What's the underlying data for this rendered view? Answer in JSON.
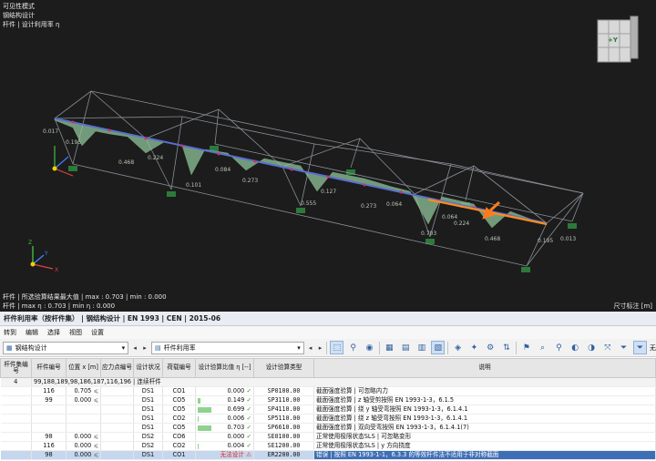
{
  "viewport": {
    "overlay_top": [
      "可见性模式",
      "钢结构设计",
      "杆件 | 设计利用率 η"
    ],
    "overlay_bottom": [
      "杆件 | 所选验算结果最大值 | max : 0.703 | min : 0.000",
      "杆件 | max η : 0.703 | min η : 0.000"
    ],
    "scale_label": "尺寸标注 [m]",
    "cube_label": "+Y",
    "axis_labels": {
      "x": "X",
      "y": "Y",
      "z": "Z"
    },
    "diagram_labels": [
      {
        "text": "0.017"
      },
      {
        "text": "0.195"
      },
      {
        "text": "0.468"
      },
      {
        "text": "0.224"
      },
      {
        "text": "0.101"
      },
      {
        "text": "0.084"
      },
      {
        "text": "0.273"
      },
      {
        "text": "0.555"
      },
      {
        "text": "0.127"
      },
      {
        "text": "0.273"
      },
      {
        "text": "0.064"
      },
      {
        "text": "0.703"
      },
      {
        "text": "0.224"
      },
      {
        "text": "0.468"
      },
      {
        "text": "0.195"
      },
      {
        "text": "0.013"
      },
      {
        "text": "0.064"
      }
    ]
  },
  "panel": {
    "title": "杆件利用率（按杆件集） | 钢结构设计 | EN 1993 | CEN | 2015-06",
    "menu": [
      "转到",
      "编辑",
      "选择",
      "视图",
      "设置"
    ],
    "combo_design": "钢结构设计",
    "combo_table": "杆件利用率",
    "toolbar_tail": "无"
  },
  "table": {
    "headers": {
      "set_no": "杆件集编号",
      "member_no": "杆件编号",
      "location": "位置 x [m]",
      "stress_point": "应力点编号",
      "design_situation": "设计状况",
      "loading": "荷载编号",
      "ratio": "设计验算比值 η [--]",
      "check_type": "设计验算类型",
      "description": "说明"
    },
    "group": {
      "set_no": "4",
      "members": "99,188,189,98,186,187,116,196 | 连续杆件"
    },
    "rows": [
      {
        "member": "116",
        "x": "0.705",
        "xmark": "⩽",
        "ds": "DS1",
        "load": "CO1",
        "ratio": "0.000",
        "ratio_val": 0.0,
        "check": "✓",
        "type": "SP0100.00",
        "desc": "截面强度验算 | 可忽略内力"
      },
      {
        "member": "99",
        "x": "0.000",
        "xmark": "⩽",
        "ds": "DS1",
        "load": "CO5",
        "ratio": "0.149",
        "ratio_val": 0.149,
        "check": "✓",
        "type": "SP3110.00",
        "desc": "截面强度验算 | z 轴受剪按照 EN 1993-1-3，6.1.5"
      },
      {
        "member": "",
        "x": "",
        "xmark": "",
        "ds": "DS1",
        "load": "CO5",
        "ratio": "0.699",
        "ratio_val": 0.699,
        "check": "✓",
        "type": "SP4110.00",
        "desc": "截面强度验算 | 绕 y 轴受弯按照 EN 1993-1-3，6.1.4.1"
      },
      {
        "member": "",
        "x": "",
        "xmark": "",
        "ds": "DS1",
        "load": "CO2",
        "ratio": "0.006",
        "ratio_val": 0.006,
        "check": "✓",
        "type": "SP5110.00",
        "desc": "截面强度验算 | 绕 z 轴受弯按照 EN 1993-1-3，6.1.4.1"
      },
      {
        "member": "",
        "x": "",
        "xmark": "",
        "ds": "DS1",
        "load": "CO5",
        "ratio": "0.703",
        "ratio_val": 0.703,
        "check": "✓",
        "type": "SP6610.00",
        "desc": "截面强度验算 | 双向受弯按照 EN 1993-1-3，6.1.4.1(7)"
      },
      {
        "member": "98",
        "x": "0.000",
        "xmark": "⩽",
        "ds": "DS2",
        "load": "CO6",
        "ratio": "0.000",
        "ratio_val": 0.0,
        "check": "✓",
        "type": "SE0100.00",
        "desc": "正常使用极限状态SLS | 可忽略变形"
      },
      {
        "member": "116",
        "x": "0.000",
        "xmark": "⩽",
        "ds": "DS2",
        "load": "CO2",
        "ratio": "0.004",
        "ratio_val": 0.004,
        "check": "✓",
        "type": "SE1200.00",
        "desc": "正常使用极限状态SLS | y 方向挠度"
      },
      {
        "member": "98",
        "x": "0.000",
        "xmark": "⩽",
        "ds": "DS1",
        "load": "CO1",
        "ratio": "无法设计",
        "ratio_val": 0,
        "check": "⚠",
        "type": "ER2200.00",
        "desc": "错误 | 按照 EN 1993-1-1，6.3.3 的等效杆件法不适用于非对称截面",
        "selected": true
      }
    ]
  },
  "colors": {
    "viewport_bg": "#1c1c1c",
    "truss_member": "#8a8f96",
    "diagram_fill": "#8fc49a",
    "highlight_member": "#5a6fd0",
    "arrow": "#ff7a1a",
    "selected_row": "#3d6fb6"
  }
}
